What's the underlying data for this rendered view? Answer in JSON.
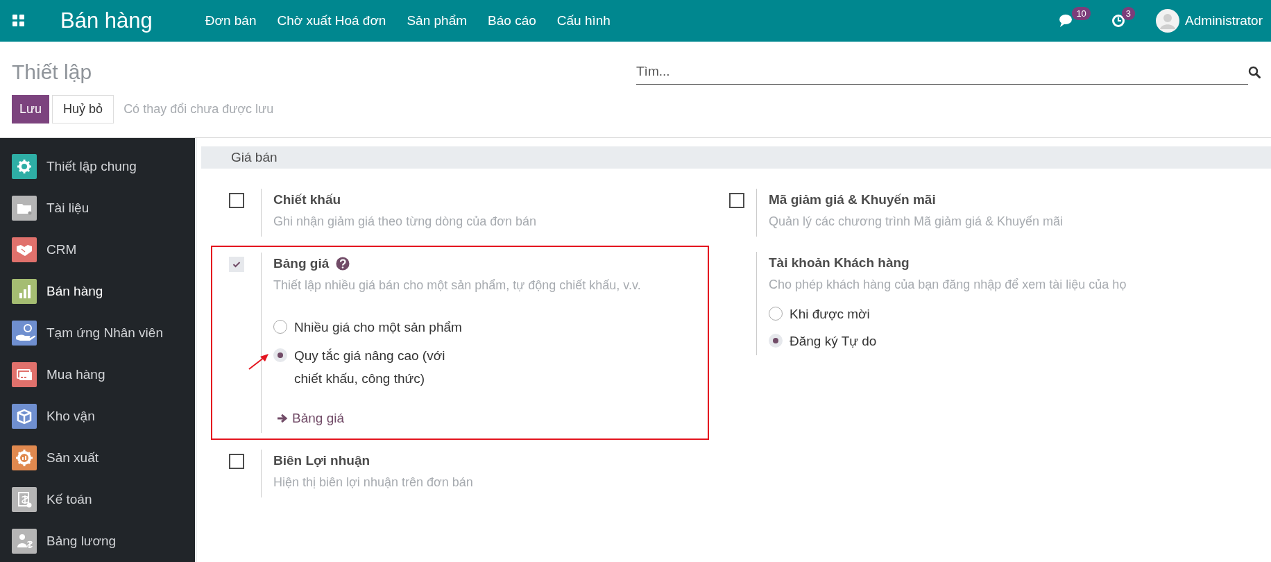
{
  "topbar": {
    "app_title": "Bán hàng",
    "menu": [
      "Đơn bán",
      "Chờ xuất Hoá đơn",
      "Sản phẩm",
      "Báo cáo",
      "Cấu hình"
    ],
    "messages_badge": "10",
    "activities_badge": "3",
    "user": "Administrator"
  },
  "control_panel": {
    "title": "Thiết lập",
    "search": {
      "placeholder": "Tìm..."
    },
    "save_button": "Lưu",
    "discard_button": "Huỷ bỏ",
    "unsaved_note": "Có thay đổi chưa được lưu"
  },
  "sidebar": {
    "items": [
      {
        "label": "Thiết lập chung",
        "color": "#2eaea5",
        "selected": false
      },
      {
        "label": "Tài liệu",
        "color": "#b5b5b5",
        "selected": false
      },
      {
        "label": "CRM",
        "color": "#e0716c",
        "selected": false
      },
      {
        "label": "Bán hàng",
        "color": "#a5bd72",
        "selected": true
      },
      {
        "label": "Tạm ứng Nhân viên",
        "color": "#6f8fcf",
        "selected": false
      },
      {
        "label": "Mua hàng",
        "color": "#e0716c",
        "selected": false
      },
      {
        "label": "Kho vận",
        "color": "#6f8fcf",
        "selected": false
      },
      {
        "label": "Sản xuất",
        "color": "#e0894f",
        "selected": false
      },
      {
        "label": "Kế toán",
        "color": "#b5b5b5",
        "selected": false
      },
      {
        "label": "Bảng lương",
        "color": "#b5b5b5",
        "selected": false
      }
    ]
  },
  "section": {
    "title": "Giá bán",
    "columns": [
      [
        {
          "kind": "checkbox",
          "title": "Chiết khấu",
          "description": "Ghi nhận giảm giá theo từng dòng của đơn bán",
          "checked": false
        },
        {
          "kind": "checkbox",
          "title": "Bảng giá",
          "help": true,
          "description": "Thiết lập nhiều giá bán cho một sản phẩm, tự động chiết khấu, v.v.",
          "checked": true,
          "highlighted": true,
          "options": [
            {
              "label": "Nhiều giá cho một sản phẩm",
              "selected": false
            },
            {
              "label": "Quy tắc giá nâng cao (với chiết khấu, công thức)",
              "selected": true,
              "pointed": true
            }
          ],
          "link": "Bảng giá"
        },
        {
          "kind": "checkbox",
          "title": "Biên Lợi nhuận",
          "description": "Hiện thị biên lợi nhuận trên đơn bán",
          "checked": false
        }
      ],
      [
        {
          "kind": "checkbox",
          "title": "Mã giảm giá & Khuyến mãi",
          "description": "Quản lý các chương trình Mã giảm giá & Khuyến mãi",
          "checked": false
        },
        {
          "kind": "plain",
          "title": "Tài khoản Khách hàng",
          "description": "Cho phép khách hàng của bạn đăng nhập để xem tài liệu của họ",
          "options": [
            {
              "label": "Khi được mời",
              "selected": false
            },
            {
              "label": "Đăng ký Tự do",
              "selected": true
            }
          ]
        }
      ]
    ]
  }
}
